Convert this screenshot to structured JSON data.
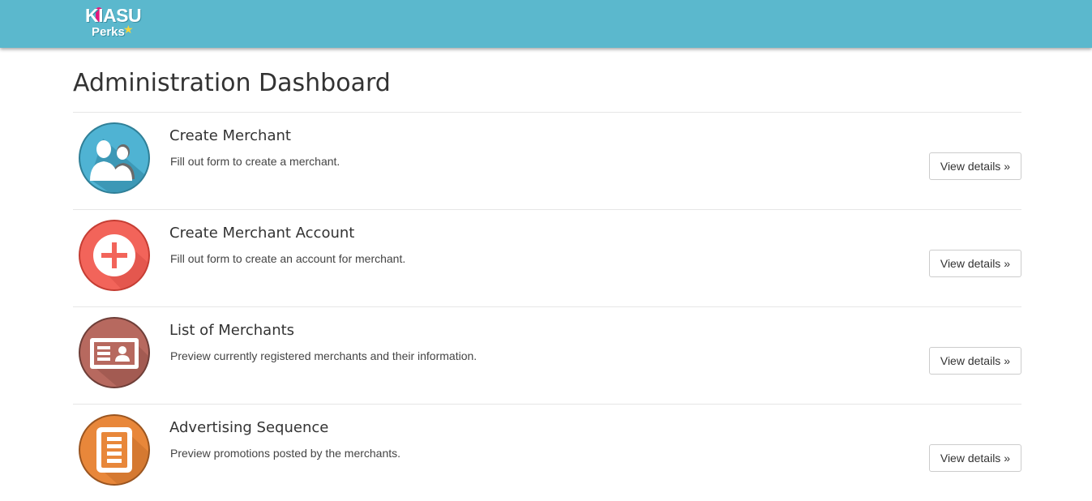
{
  "brand": {
    "line1": "KIASU",
    "line2": "Perks"
  },
  "page": {
    "title": "Administration Dashboard"
  },
  "items": [
    {
      "title": "Create Merchant",
      "description": "Fill out form to create a merchant.",
      "button": "View details »",
      "icon": "users-icon",
      "color": "#4fb3d3"
    },
    {
      "title": "Create Merchant Account",
      "description": "Fill out form to create an account for merchant.",
      "button": "View details »",
      "icon": "plus-icon",
      "color": "#f2645a"
    },
    {
      "title": "List of Merchants",
      "description": "Preview currently registered merchants and their information.",
      "button": "View details »",
      "icon": "id-card-icon",
      "color": "#b7695f"
    },
    {
      "title": "Advertising Sequence",
      "description": "Preview promotions posted by the merchants.",
      "button": "View details »",
      "icon": "document-icon",
      "color": "#e8873a"
    }
  ]
}
